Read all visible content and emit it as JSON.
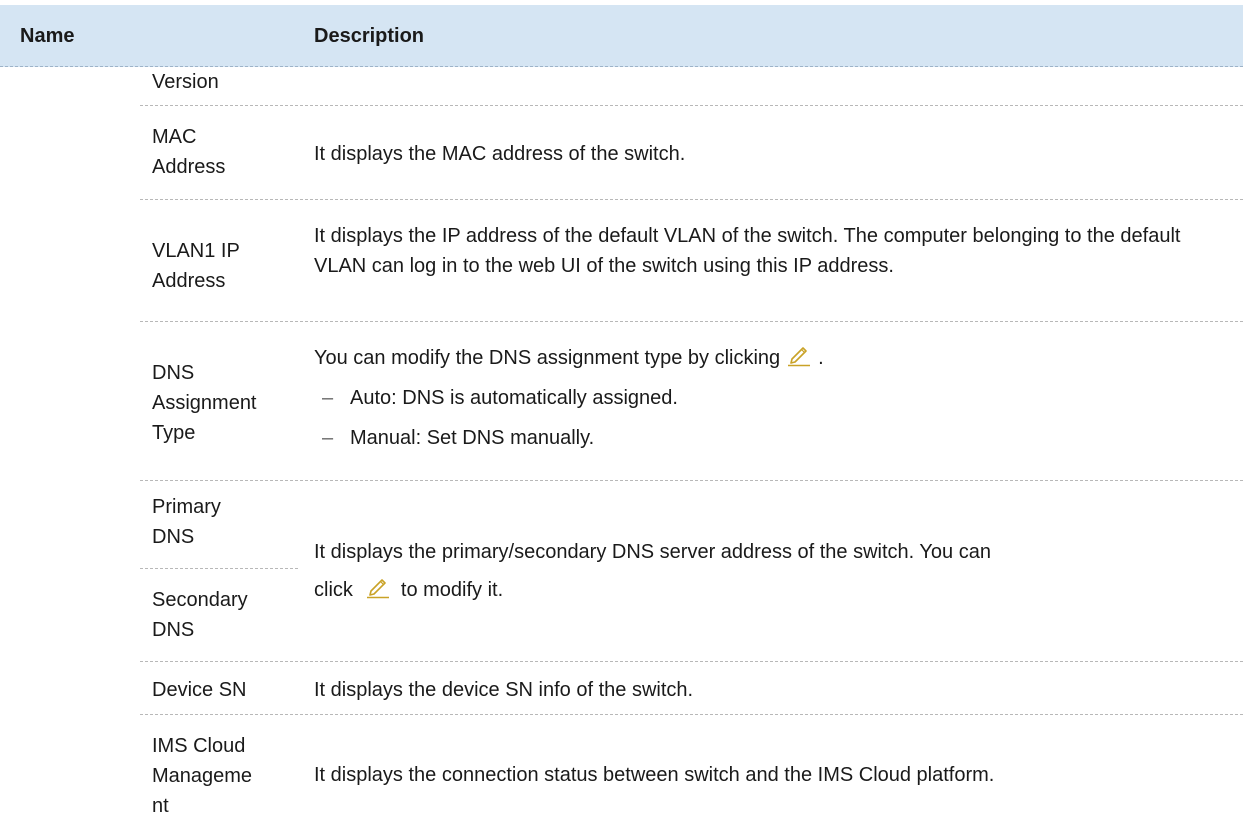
{
  "header": {
    "name_label": "Name",
    "description_label": "Description"
  },
  "rows": {
    "version": {
      "name": "Version"
    },
    "mac": {
      "name": "MAC Address",
      "description": "It displays the MAC address of the switch."
    },
    "vlan": {
      "name": "VLAN1 IP Address",
      "description": "It displays the IP address of the default VLAN of the switch. The computer belonging to the default VLAN can log in to the web UI of the switch using this IP address."
    },
    "dns_type": {
      "name": "DNS Assignment Type",
      "description_prefix": "You can modify the DNS assignment type by clicking",
      "description_suffix": ".",
      "bullets": [
        "Auto: DNS is automatically assigned.",
        "Manual: Set DNS manually."
      ],
      "bullet_marker": "–"
    },
    "primary_dns": {
      "name": "Primary DNS"
    },
    "secondary_dns": {
      "name": "Secondary DNS"
    },
    "dns_shared": {
      "description_line1": "It displays the primary/secondary DNS server address of the switch. You can",
      "description_line2_prefix": "click",
      "description_line2_suffix": "to modify it."
    },
    "device_sn": {
      "name": "Device SN",
      "description": "It displays the device SN info of the switch."
    },
    "ims": {
      "name": "IMS Cloud Manageme nt",
      "description": "It displays the connection status between switch and the IMS Cloud platform."
    }
  },
  "icons": {
    "edit": "pencil-icon",
    "edit_color": "#c9a227"
  }
}
